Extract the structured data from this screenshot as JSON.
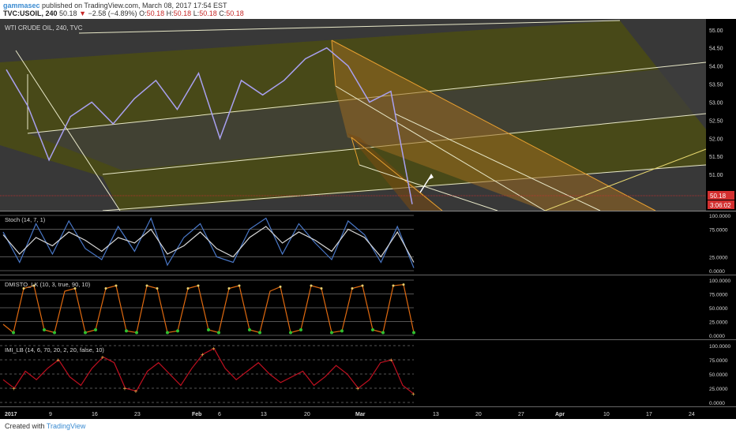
{
  "header": {
    "author": "gammasec",
    "published": "published on TradingView.com, March 08, 2017 17:54 EST",
    "symbol": "TVC:USOIL, 240",
    "last": "50.18",
    "change_arrow": "▼",
    "change": "−2.58 (−4.89%)",
    "o_label": "O:",
    "o": "50.18",
    "h_label": "H:",
    "h": "50.18",
    "l_label": "L:",
    "l": "50.18",
    "c_label": "C:",
    "c": "50.18"
  },
  "footer": {
    "created_with": "Created with",
    "brand": "TradingView"
  },
  "colors": {
    "bg": "#000000",
    "panel_bg": "#383838",
    "candle": "#a8a0f0",
    "channel": "#f0f0d0",
    "orange": "#e8a030",
    "olive": "#55561a",
    "price_label_bg": "#d32f2f",
    "stoch_fast": "#4a78c8",
    "stoch_slow": "#d8d8d8",
    "dmi_line": "#e06a10",
    "imi_line": "#c01020",
    "dots": "#f0c050"
  },
  "chart_data": [
    {
      "type": "line",
      "title": "WTI CRUDE OIL, 240, TVC",
      "ylim": [
        50.0,
        55.3
      ],
      "y_ticks": [
        "55.00",
        "54.50",
        "54.00",
        "53.50",
        "53.00",
        "52.50",
        "52.00",
        "51.50",
        "51.00"
      ],
      "last_price_label": "50.18",
      "countdown_label": "3:06:02",
      "x_labels": [
        "2017",
        "9",
        "16",
        "23",
        "Feb",
        "6",
        "13",
        "20",
        "Mar",
        "13",
        "20",
        "27",
        "Apr",
        "10",
        "17",
        "24"
      ],
      "series": [
        {
          "x": [
            "2017-01-03",
            "2017-01-06",
            "2017-01-09",
            "2017-01-12",
            "2017-01-16",
            "2017-01-19",
            "2017-01-23",
            "2017-01-26",
            "2017-01-30",
            "2017-02-02",
            "2017-02-06",
            "2017-02-09",
            "2017-02-13",
            "2017-02-16",
            "2017-02-20",
            "2017-02-23",
            "2017-02-27",
            "2017-03-02",
            "2017-03-06",
            "2017-03-08"
          ],
          "values": [
            53.9,
            52.9,
            51.4,
            52.6,
            53.0,
            52.4,
            53.1,
            53.6,
            52.8,
            53.8,
            52.0,
            53.6,
            53.2,
            53.6,
            54.2,
            54.5,
            54.0,
            53.0,
            53.3,
            50.18
          ]
        }
      ]
    },
    {
      "type": "line",
      "title": "Stoch (14, 7, 1)",
      "ylim": [
        0,
        100
      ],
      "y_ticks": [
        "100.0000",
        "75.0000",
        "25.0000",
        "0.0000"
      ],
      "series": [
        {
          "values": [
            70,
            15,
            85,
            30,
            90,
            40,
            20,
            80,
            35,
            95,
            10,
            60,
            85,
            25,
            15,
            75,
            95,
            30,
            85,
            50,
            20,
            90,
            65,
            15,
            80,
            5
          ]
        },
        {
          "values": [
            65,
            30,
            60,
            45,
            70,
            55,
            35,
            60,
            50,
            75,
            30,
            45,
            70,
            40,
            25,
            60,
            80,
            50,
            70,
            55,
            35,
            75,
            60,
            25,
            70,
            15
          ]
        }
      ]
    },
    {
      "type": "line",
      "title": "DMISTO_LK (10, 3, true, 90, 10)",
      "ylim": [
        0,
        100
      ],
      "y_ticks": [
        "100.0000",
        "75.0000",
        "50.0000",
        "25.0000",
        "0.0000"
      ],
      "series": [
        {
          "values": [
            20,
            5,
            85,
            90,
            10,
            5,
            80,
            85,
            5,
            10,
            85,
            90,
            8,
            5,
            90,
            85,
            5,
            8,
            85,
            90,
            10,
            5,
            85,
            90,
            10,
            5,
            80,
            88,
            5,
            10,
            90,
            85,
            5,
            8,
            85,
            90,
            10,
            5,
            90,
            92,
            5
          ]
        }
      ]
    },
    {
      "type": "line",
      "title": "IMI_LB (14, 6, 70, 20, 2, 20, false, 10)",
      "ylim": [
        0,
        100
      ],
      "y_ticks": [
        "100.0000",
        "75.0000",
        "50.0000",
        "25.0000",
        "0.0000"
      ],
      "series": [
        {
          "values": [
            40,
            25,
            55,
            40,
            60,
            75,
            45,
            30,
            60,
            80,
            70,
            25,
            20,
            55,
            70,
            50,
            30,
            60,
            85,
            95,
            60,
            40,
            55,
            70,
            50,
            35,
            45,
            55,
            30,
            45,
            65,
            50,
            25,
            40,
            70,
            75,
            30,
            15
          ]
        }
      ]
    }
  ]
}
